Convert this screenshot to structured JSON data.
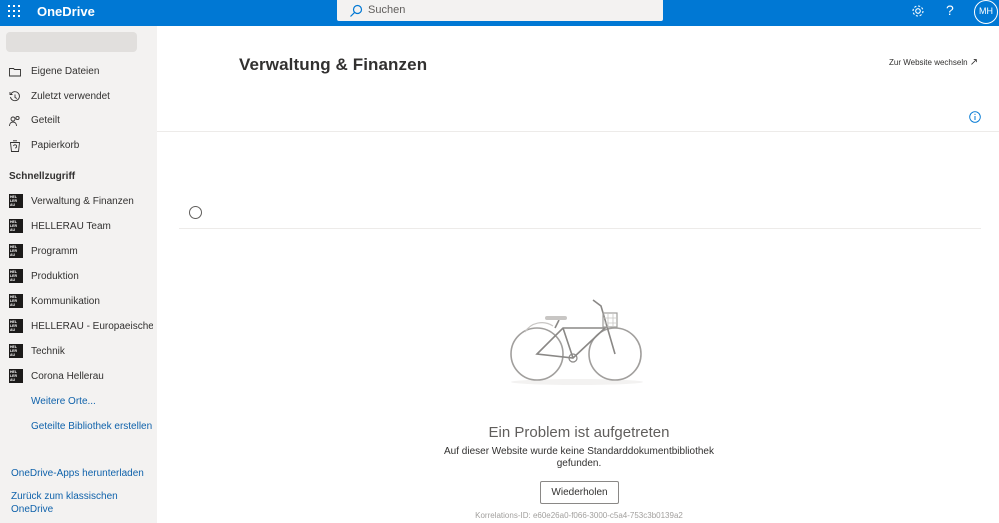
{
  "topbar": {
    "app_name": "OneDrive",
    "search_placeholder": "Suchen",
    "help_label": "?",
    "avatar_initials": "MH"
  },
  "sidebar": {
    "nav_items": [
      {
        "label": "Eigene Dateien",
        "icon": "folder-icon"
      },
      {
        "label": "Zuletzt verwendet",
        "icon": "history-icon"
      },
      {
        "label": "Geteilt",
        "icon": "people-icon"
      },
      {
        "label": "Papierkorb",
        "icon": "recycle-bin-icon"
      }
    ],
    "quick_access_title": "Schnellzugriff",
    "quick_access": [
      "Verwaltung & Finanzen",
      "HELLERAU Team",
      "Programm",
      "Produktion",
      "Kommunikation",
      "HELLERAU - Europaeische...",
      "Technik",
      "Corona Hellerau"
    ],
    "site_logo_text": "HEL LER AU",
    "more_places": "Weitere Orte...",
    "create_library": "Geteilte Bibliothek erstellen",
    "download_apps": "OneDrive-Apps herunterladen",
    "back_classic_line1": "Zurück zum klassischen",
    "back_classic_line2": "OneDrive"
  },
  "main": {
    "title": "Verwaltung & Finanzen",
    "switch_site": "Zur Website wechseln",
    "switch_icon": "↗",
    "error_title": "Ein Problem ist aufgetreten",
    "error_desc_line1": "Auf dieser Website wurde keine Standarddokumentbibliothek",
    "error_desc_line2": "gefunden.",
    "retry_label": "Wiederholen",
    "correlation": "Korrelations-ID: e60e26a0-f066-3000-c5a4-753c3b0139a2"
  },
  "colors": {
    "brand": "#0078d4",
    "link": "#0f62ab",
    "sidebar_bg": "#f3f2f1"
  }
}
